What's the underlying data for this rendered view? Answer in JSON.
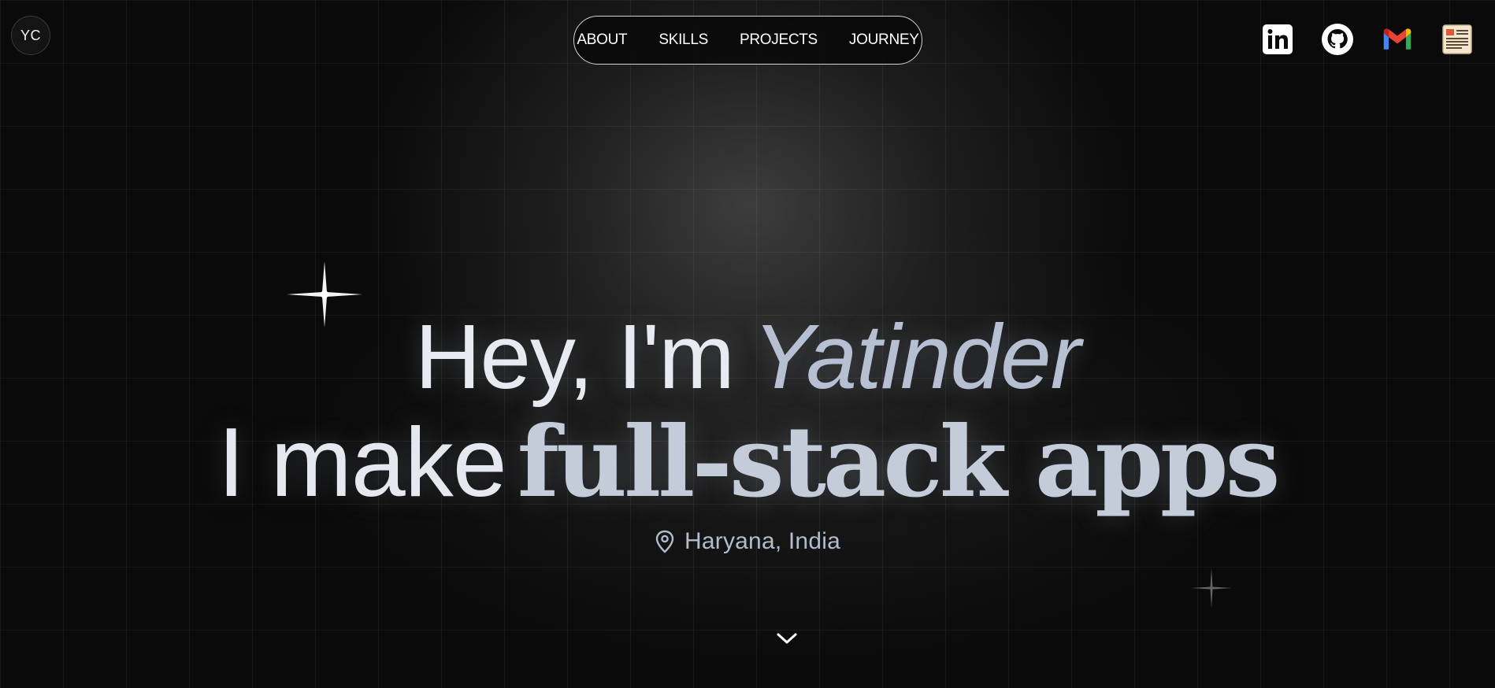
{
  "logo": {
    "initials": "YC"
  },
  "nav": {
    "items": [
      {
        "label": "ABOUT"
      },
      {
        "label": "SKILLS"
      },
      {
        "label": "PROJECTS"
      },
      {
        "label": "JOURNEY"
      }
    ]
  },
  "socials": [
    {
      "icon": "linkedin-icon"
    },
    {
      "icon": "github-icon"
    },
    {
      "icon": "gmail-icon"
    },
    {
      "icon": "resume-icon"
    }
  ],
  "hero": {
    "greeting": "Hey, I'm",
    "name": "Yatinder",
    "make_prefix": "I make",
    "make_highlight": "full-stack apps",
    "location": "Haryana, India"
  },
  "colors": {
    "background": "#0a0a0a",
    "headline": "#e7eaf1",
    "accent": "#b6c0d2",
    "nav_border": "#d4d4d4"
  }
}
